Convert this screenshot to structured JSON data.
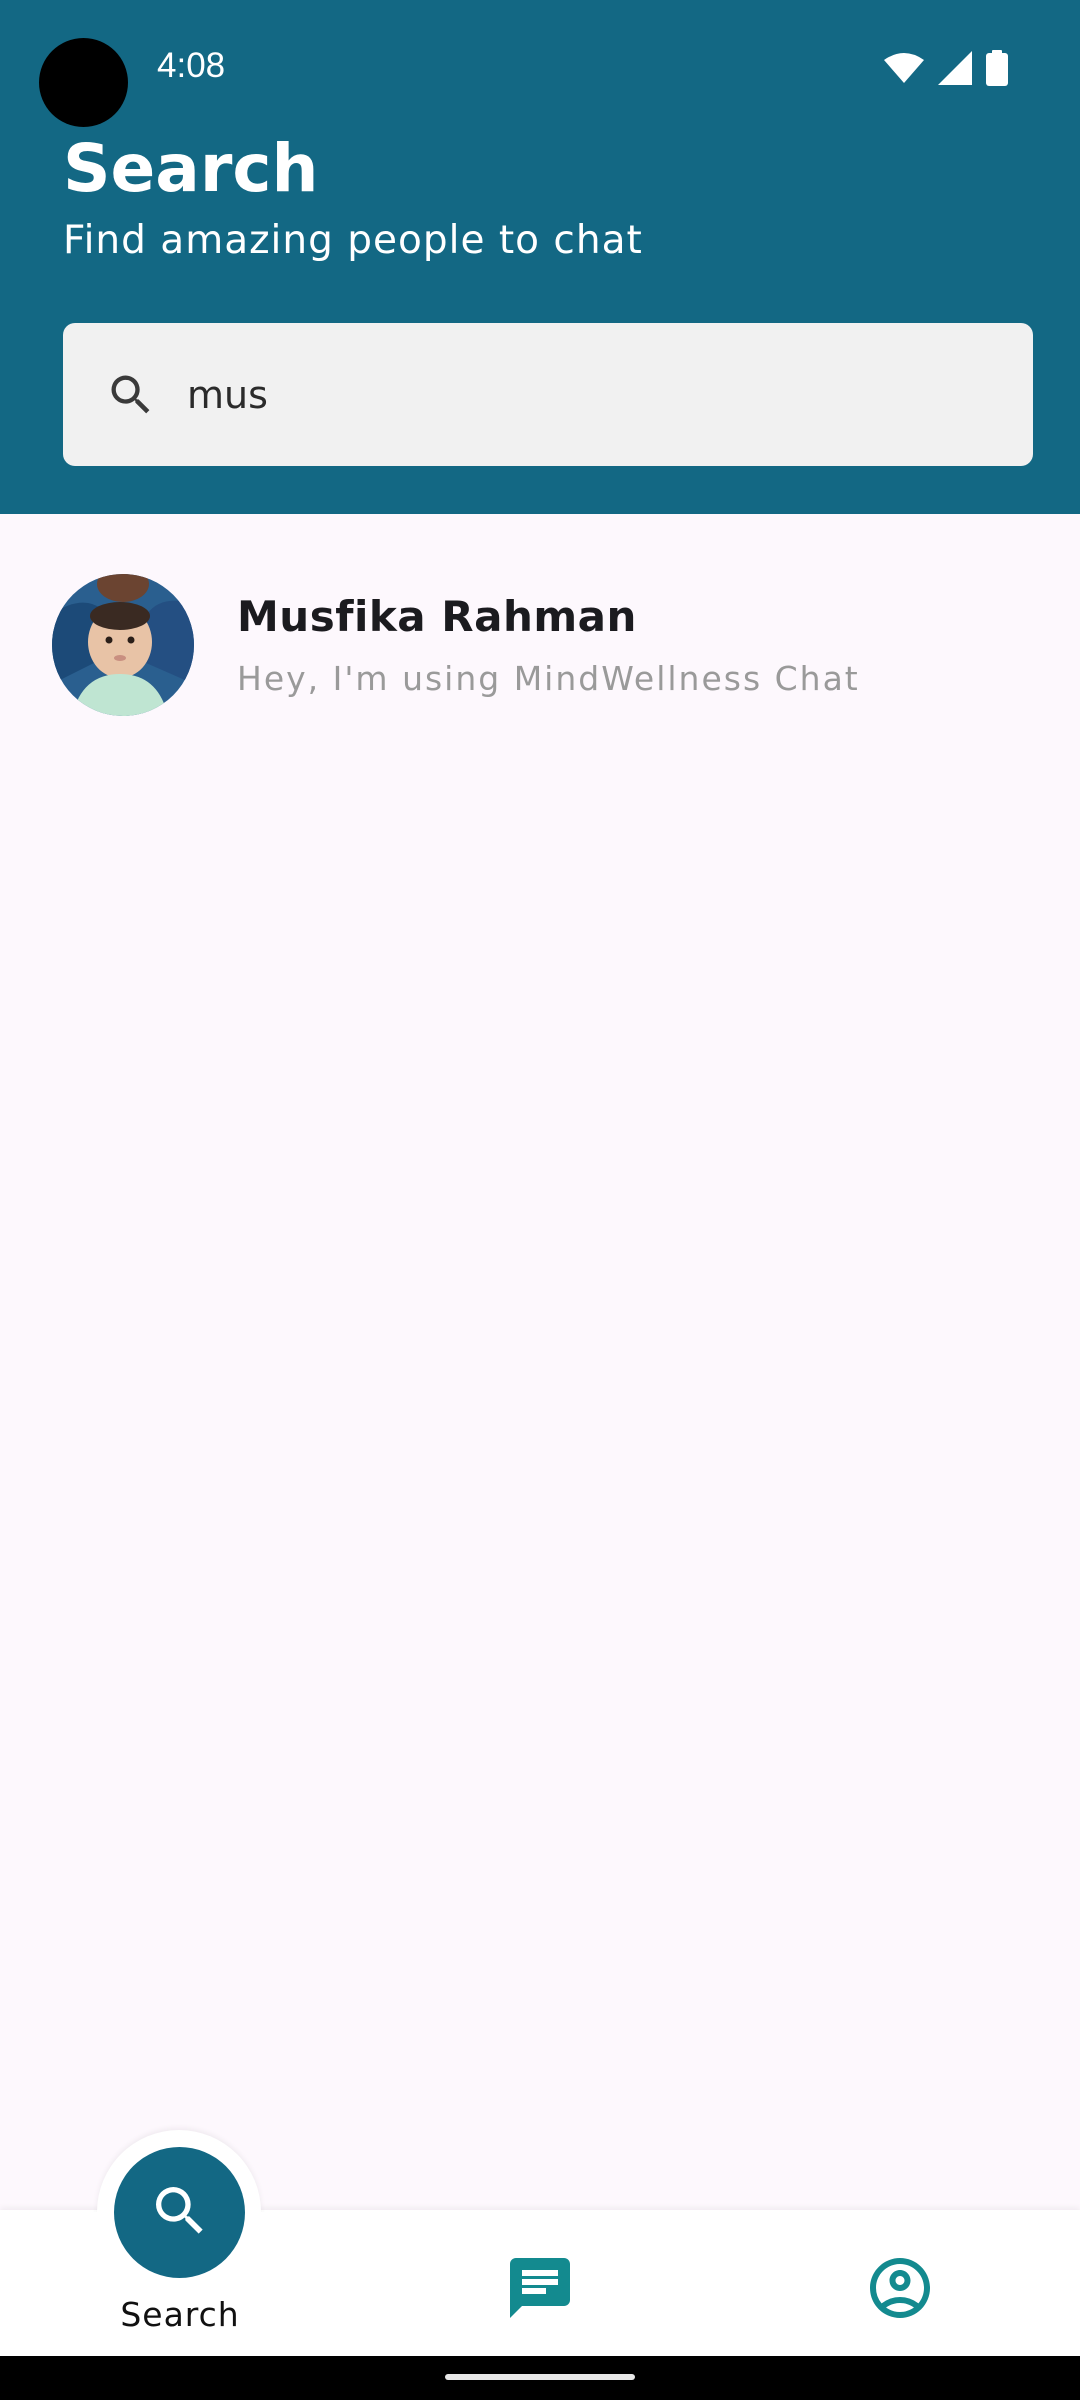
{
  "status_bar": {
    "time": "4:08",
    "icons": [
      "wifi-icon",
      "signal-icon",
      "battery-icon"
    ]
  },
  "header": {
    "title": "Search",
    "subtitle": "Find amazing people to chat",
    "color": "#136884"
  },
  "search": {
    "icon": "search-icon",
    "value": "mus"
  },
  "results": [
    {
      "name": "Musfika Rahman",
      "status": "Hey, I'm using MindWellness Chat",
      "avatar": "avatar-photo"
    }
  ],
  "bottom_nav": {
    "active": "search",
    "items": [
      {
        "id": "search",
        "label": "Search",
        "icon": "search-icon"
      },
      {
        "id": "chats",
        "label": "",
        "icon": "chat-icon"
      },
      {
        "id": "profile",
        "label": "",
        "icon": "account-circle-icon"
      }
    ],
    "accent": "#138a8f"
  }
}
